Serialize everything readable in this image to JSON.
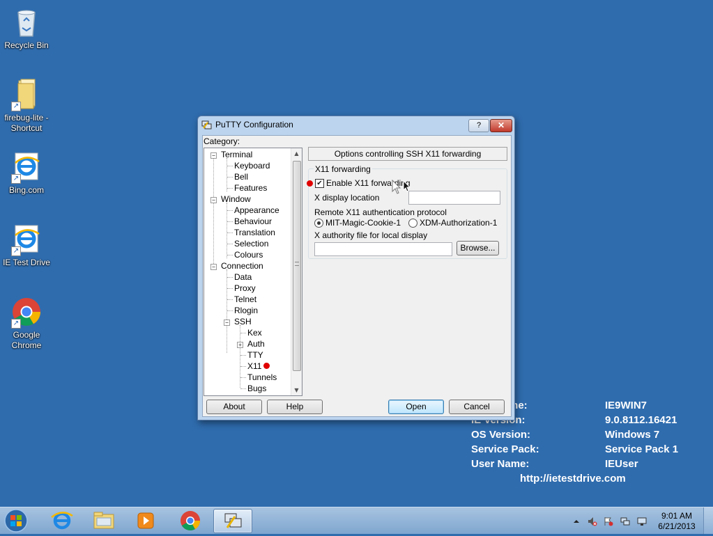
{
  "desktop": {
    "icons": [
      {
        "label": "Recycle Bin"
      },
      {
        "label": "firebug-lite - Shortcut"
      },
      {
        "label": "Bing.com"
      },
      {
        "label": "IE Test Drive"
      },
      {
        "label": "Google Chrome"
      }
    ],
    "info": {
      "rows": [
        {
          "key": "me:",
          "value": "IE9WIN7"
        },
        {
          "key": "IE Version:",
          "value": "9.0.8112.16421"
        },
        {
          "key": "OS Version:",
          "value": "Windows 7"
        },
        {
          "key": "Service Pack:",
          "value": "Service Pack 1"
        },
        {
          "key": "User Name:",
          "value": "IEUser"
        }
      ],
      "url": "http://ietestdrive.com"
    }
  },
  "dialog": {
    "title": "PuTTY Configuration",
    "title_buttons": {
      "help": "?",
      "close": "✕"
    },
    "category_label": "Category:",
    "tree": [
      {
        "label": "Terminal"
      },
      {
        "label": "Keyboard"
      },
      {
        "label": "Bell"
      },
      {
        "label": "Features"
      },
      {
        "label": "Window"
      },
      {
        "label": "Appearance"
      },
      {
        "label": "Behaviour"
      },
      {
        "label": "Translation"
      },
      {
        "label": "Selection"
      },
      {
        "label": "Colours"
      },
      {
        "label": "Connection"
      },
      {
        "label": "Data"
      },
      {
        "label": "Proxy"
      },
      {
        "label": "Telnet"
      },
      {
        "label": "Rlogin"
      },
      {
        "label": "SSH"
      },
      {
        "label": "Kex"
      },
      {
        "label": "Auth"
      },
      {
        "label": "TTY"
      },
      {
        "label": "X11"
      },
      {
        "label": "Tunnels"
      },
      {
        "label": "Bugs"
      }
    ],
    "panel_header": "Options controlling SSH X11 forwarding",
    "group_title": "X11 forwarding",
    "enable_x11": {
      "label": "Enable X11 forwarding",
      "checked": true
    },
    "x_display": {
      "label": "X display location",
      "value": ""
    },
    "auth_protocol": {
      "label": "Remote X11 authentication protocol",
      "options": [
        "MIT-Magic-Cookie-1",
        "XDM-Authorization-1"
      ],
      "selected": "MIT-Magic-Cookie-1"
    },
    "xauth_file": {
      "label": "X authority file for local display",
      "value": ""
    },
    "buttons": {
      "browse": "Browse...",
      "about": "About",
      "help": "Help",
      "open": "Open",
      "cancel": "Cancel"
    },
    "marker_color": "#e00000"
  },
  "taskbar": {
    "apps": [
      "internet-explorer-icon",
      "windows-explorer-icon",
      "media-player-icon",
      "chrome-icon",
      "putty-icon"
    ],
    "clock": {
      "time": "9:01 AM",
      "date": "6/21/2013"
    }
  }
}
